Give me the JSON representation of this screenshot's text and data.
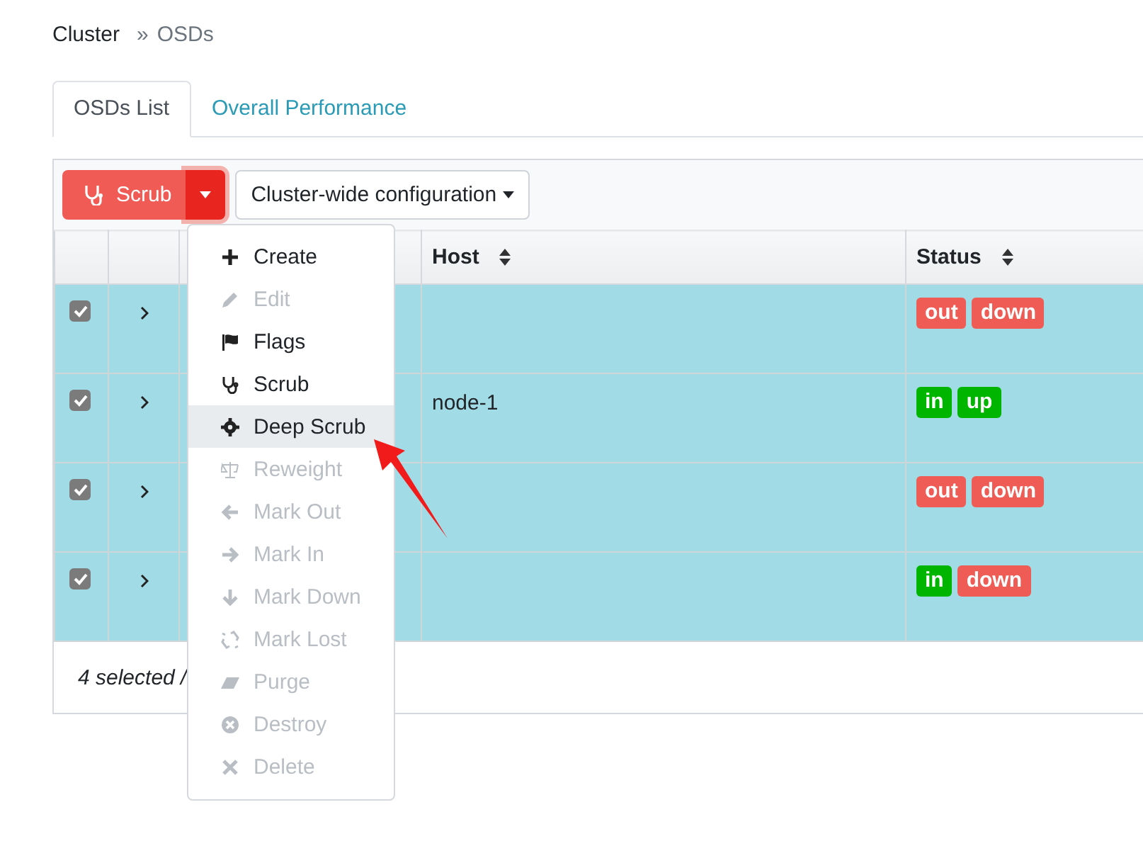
{
  "breadcrumb": {
    "items": [
      "Cluster",
      "OSDs"
    ],
    "separator": "»"
  },
  "tabs": [
    {
      "label": "OSDs List",
      "selected": true
    },
    {
      "label": "Overall Performance",
      "selected": false
    }
  ],
  "toolbar": {
    "primary_button": "Scrub",
    "config_button": "Cluster-wide configuration"
  },
  "dropdown_menu": [
    {
      "label": "Create",
      "disabled": false,
      "selected": false
    },
    {
      "label": "Edit",
      "disabled": true,
      "selected": false
    },
    {
      "label": "Flags",
      "disabled": false,
      "selected": false
    },
    {
      "label": "Scrub",
      "disabled": false,
      "selected": false
    },
    {
      "label": "Deep Scrub",
      "disabled": false,
      "selected": true
    },
    {
      "label": "Reweight",
      "disabled": true,
      "selected": false
    },
    {
      "label": "Mark Out",
      "disabled": true,
      "selected": false
    },
    {
      "label": "Mark In",
      "disabled": true,
      "selected": false
    },
    {
      "label": "Mark Down",
      "disabled": true,
      "selected": false
    },
    {
      "label": "Mark Lost",
      "disabled": true,
      "selected": false
    },
    {
      "label": "Purge",
      "disabled": true,
      "selected": false
    },
    {
      "label": "Destroy",
      "disabled": true,
      "selected": false
    },
    {
      "label": "Delete",
      "disabled": true,
      "selected": false
    }
  ],
  "table": {
    "columns": [
      "Host",
      "Status"
    ],
    "rows": [
      {
        "checked": true,
        "expanded": false,
        "status": [
          {
            "label": "out",
            "color": "#ef5c55"
          },
          {
            "label": "down",
            "color": "#ef5c55"
          }
        ]
      },
      {
        "checked": true,
        "expanded": false,
        "host": "node-1",
        "status": [
          {
            "label": "in",
            "color": "#00b500"
          },
          {
            "label": "up",
            "color": "#00b500"
          }
        ]
      },
      {
        "checked": true,
        "expanded": false,
        "status": [
          {
            "label": "out",
            "color": "#ef5c55"
          },
          {
            "label": "down",
            "color": "#ef5c55"
          }
        ]
      },
      {
        "checked": true,
        "expanded": false,
        "status": [
          {
            "label": "in",
            "color": "#00b500"
          },
          {
            "label": "down",
            "color": "#ef5c55"
          }
        ]
      }
    ],
    "footer": "4 selected /"
  }
}
